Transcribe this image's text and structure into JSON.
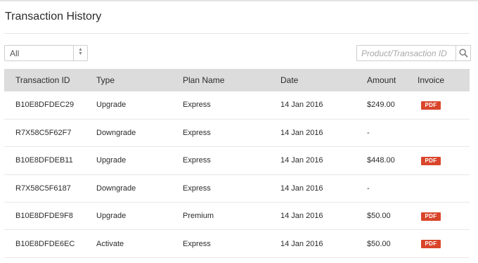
{
  "page": {
    "title": "Transaction History"
  },
  "filter": {
    "selected": "All"
  },
  "search": {
    "placeholder": "Product/Transaction ID"
  },
  "table": {
    "headers": {
      "transaction_id": "Transaction ID",
      "type": "Type",
      "plan_name": "Plan Name",
      "date": "Date",
      "amount": "Amount",
      "invoice": "Invoice"
    },
    "rows": [
      {
        "id": "B10E8DFDEC29",
        "type": "Upgrade",
        "plan": "Express",
        "date": "14 Jan 2016",
        "amount": "$249.00",
        "invoice": "PDF"
      },
      {
        "id": "R7X58C5F62F7",
        "type": "Downgrade",
        "plan": "Express",
        "date": "14 Jan 2016",
        "amount": "-",
        "invoice": ""
      },
      {
        "id": "B10E8DFDEB11",
        "type": "Upgrade",
        "plan": "Express",
        "date": "14 Jan 2016",
        "amount": "$448.00",
        "invoice": "PDF"
      },
      {
        "id": "R7X58C5F6187",
        "type": "Downgrade",
        "plan": "Express",
        "date": "14 Jan 2016",
        "amount": "-",
        "invoice": ""
      },
      {
        "id": "B10E8DFDE9F8",
        "type": "Upgrade",
        "plan": "Premium",
        "date": "14 Jan 2016",
        "amount": "$50.00",
        "invoice": "PDF"
      },
      {
        "id": "B10E8DFDE6EC",
        "type": "Activate",
        "plan": "Express",
        "date": "14 Jan 2016",
        "amount": "$50.00",
        "invoice": "PDF"
      }
    ]
  },
  "colors": {
    "pdf_badge": "#d9452b",
    "header_bg": "#dcdcdc"
  },
  "icons": {
    "search": "search-icon",
    "select_arrows": "select-arrows-icon",
    "invoice": "pdf-icon"
  }
}
